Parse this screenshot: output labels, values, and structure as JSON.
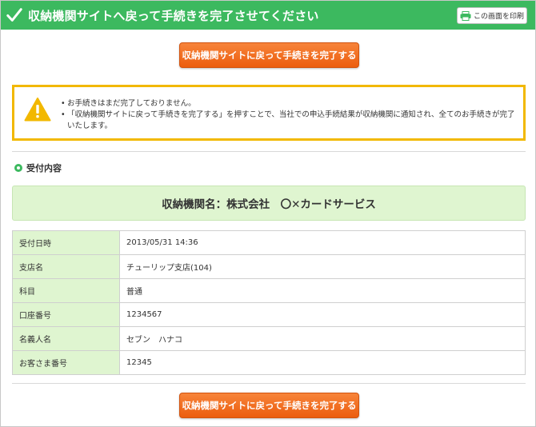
{
  "header": {
    "title": "収納機関サイトへ戻って手続きを完了させてください",
    "print_label": "この画面を印刷",
    "color": "#3cb95f"
  },
  "buttons": {
    "complete_label": "収納機関サイトに戻って手続きを完了する",
    "color": "#ec5d0e"
  },
  "warning": {
    "items": [
      "お手続きはまだ完了しておりません。",
      "「収納機関サイトに戻って手続きを完了する」を押すことで、当社での申込手続結果が収納機関に通知され、全てのお手続きが完了いたします。"
    ],
    "border_color": "#f2b800"
  },
  "section": {
    "title": "受付内容"
  },
  "merchant": {
    "text": "収納機関名：株式会社　〇✕カードサービス"
  },
  "details": [
    {
      "label": "受付日時",
      "value": "2013/05/31 14:36"
    },
    {
      "label": "支店名",
      "value": "チューリップ支店(104)"
    },
    {
      "label": "科目",
      "value": "普通"
    },
    {
      "label": "口座番号",
      "value": "1234567"
    },
    {
      "label": "名義人名",
      "value": "セブン　ハナコ"
    },
    {
      "label": "お客さま番号",
      "value": "12345"
    }
  ]
}
